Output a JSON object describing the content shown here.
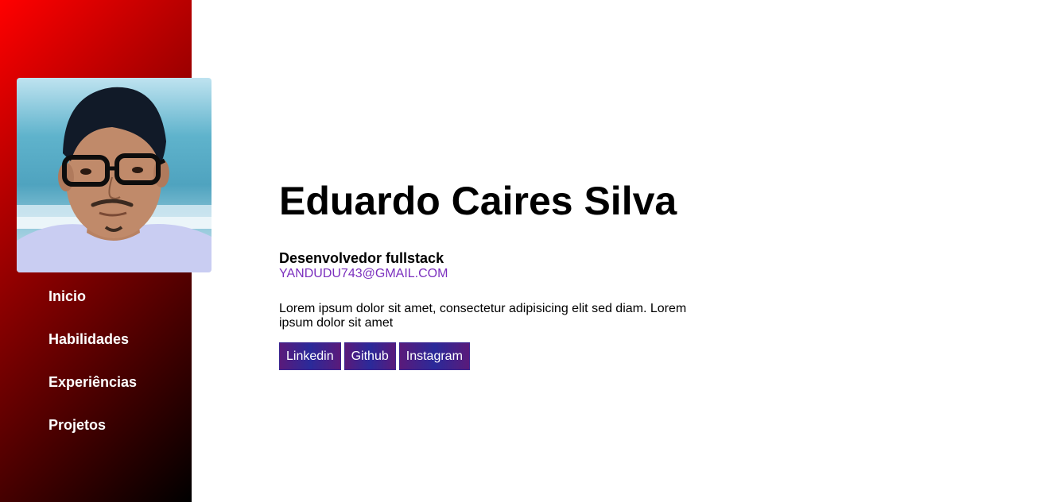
{
  "profile": {
    "name": "Eduardo Caires Silva",
    "role": "Desenvolvedor fullstack",
    "email": "YANDUDU743@GMAIL.COM",
    "bio": "Lorem ipsum dolor sit amet, consectetur adipisicing elit sed diam. Lorem ipsum dolor sit amet"
  },
  "nav": {
    "items": [
      {
        "label": "Inicio"
      },
      {
        "label": "Habilidades"
      },
      {
        "label": "Experiências"
      },
      {
        "label": "Projetos"
      }
    ]
  },
  "links": [
    {
      "label": "Linkedin"
    },
    {
      "label": "Github"
    },
    {
      "label": "Instagram"
    }
  ],
  "colors": {
    "sidebar_gradient_start": "#ff0000",
    "sidebar_gradient_end": "#000000",
    "email": "#7b2fbe",
    "link_button": "#5a1a7a",
    "link_text": "#ffffff"
  },
  "icons": {
    "avatar": "profile-photo"
  }
}
